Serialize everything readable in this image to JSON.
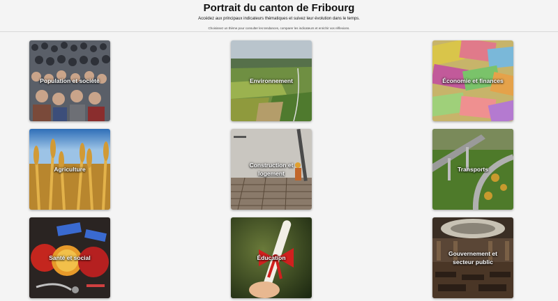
{
  "header": {
    "title": "Portrait du canton de Fribourg",
    "subtitle": "Accédez aux principaux indicateurs thématiques et suivez leur évolution dans le temps.",
    "hint": "Choisissez un thème pour consulter les tendances, comparer les indicateurs et enrichir vos réflexions."
  },
  "themes": [
    {
      "label": "Population et société"
    },
    {
      "label": "Environnement"
    },
    {
      "label": "Économie et finances"
    },
    {
      "label": "Agriculture"
    },
    {
      "label": "Construction et logement"
    },
    {
      "label": "Transports"
    },
    {
      "label": "Santé et social"
    },
    {
      "label": "Éducation"
    },
    {
      "label": "Gouvernement et secteur public"
    }
  ]
}
